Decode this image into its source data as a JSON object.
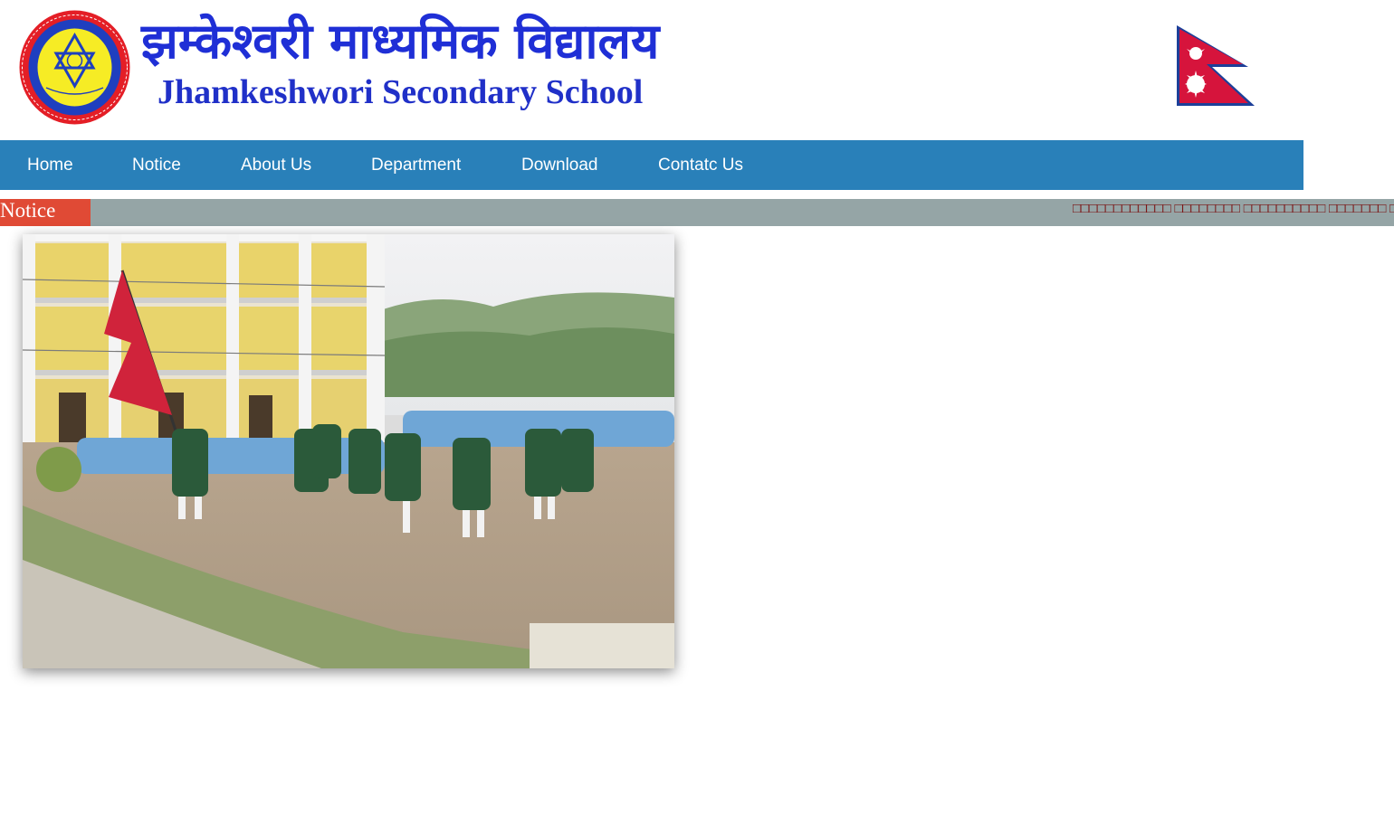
{
  "header": {
    "title_np": "झम्केश्वरी माध्यमिक विद्यालय",
    "title_en": "Jhamkeshwori Secondary School",
    "logo_icon": "school-emblem-icon",
    "flag_icon": "nepal-flag-icon"
  },
  "nav": {
    "items": [
      {
        "label": "Home"
      },
      {
        "label": "Notice"
      },
      {
        "label": "About Us"
      },
      {
        "label": "Department"
      },
      {
        "label": "Download"
      },
      {
        "label": "Contatc Us"
      }
    ]
  },
  "ticker": {
    "label": "Notice",
    "text": "□□□□□□□□□□□□ □□□□□□□□ □□□□□□□□□□ □□□□□□□ □□□□□□ □ □"
  },
  "slideshow": {
    "image_icon": "school-assembly-photo"
  },
  "colors": {
    "nav_bg": "#2980b9",
    "ticker_bg": "#95a5a6",
    "ticker_label_bg": "#e04a35",
    "title_color": "#1f2fd6",
    "ticker_text_color": "#7a1010"
  }
}
